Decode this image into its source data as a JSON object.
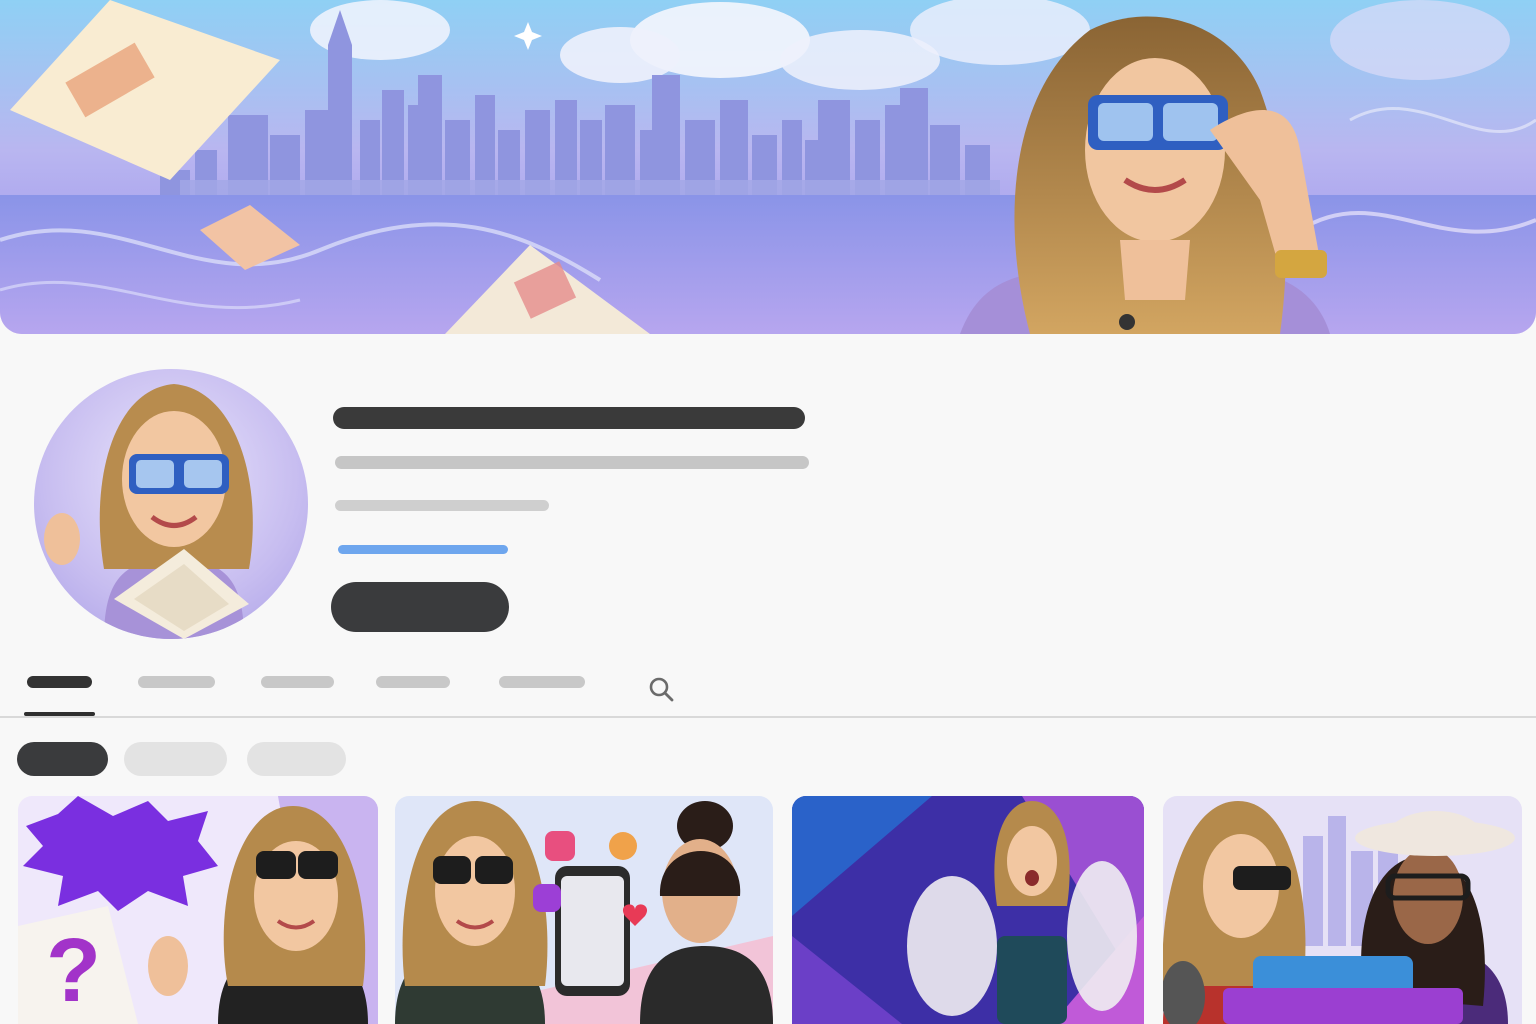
{
  "channel": {
    "name": "",
    "handle": "",
    "description": "",
    "link": "",
    "subscribe_label": ""
  },
  "tabs": [
    {
      "label": "",
      "active": true
    },
    {
      "label": "",
      "active": false
    },
    {
      "label": "",
      "active": false
    },
    {
      "label": "",
      "active": false
    },
    {
      "label": "",
      "active": false
    }
  ],
  "chips": [
    {
      "label": "",
      "active": true
    },
    {
      "label": "",
      "active": false
    },
    {
      "label": "",
      "active": false
    }
  ],
  "videos": [
    {
      "title": ""
    },
    {
      "title": ""
    },
    {
      "title": ""
    },
    {
      "title": ""
    }
  ],
  "icons": {
    "search": "search-icon",
    "instagram": "instagram-icon",
    "heart": "heart-icon"
  },
  "colors": {
    "accent_link": "#6ea6ee",
    "primary_dark": "#3a3b3d",
    "skeleton_light": "#c8c8c8"
  }
}
